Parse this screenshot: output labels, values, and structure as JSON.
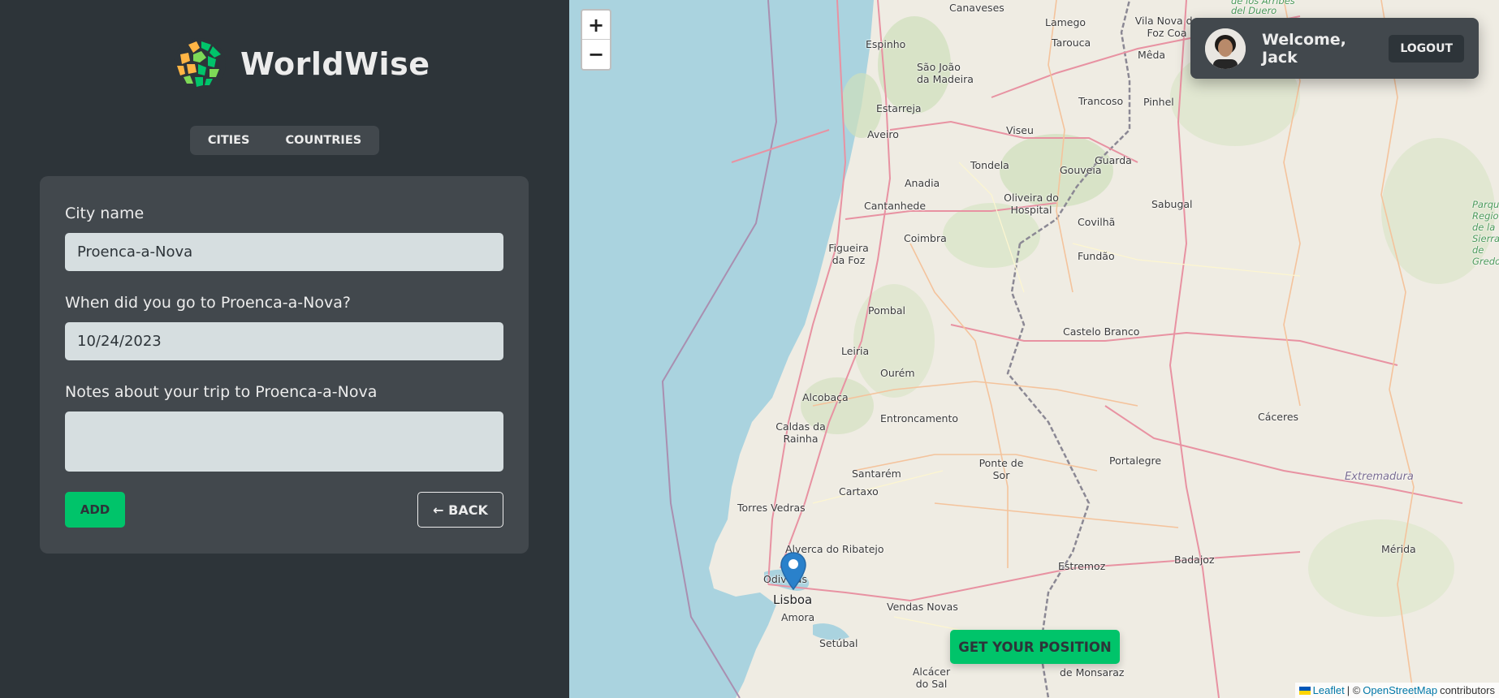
{
  "app": {
    "brand": "WorldWise",
    "brand_colors": {
      "orange": "#ffb545",
      "green": "#00c46a",
      "dark": "#2d3439"
    }
  },
  "nav": {
    "items": [
      {
        "label": "CITIES"
      },
      {
        "label": "COUNTRIES"
      }
    ]
  },
  "form": {
    "city_label": "City name",
    "city_value": "Proenca-a-Nova",
    "date_label": "When did you go to Proenca-a-Nova?",
    "date_value": "10/24/2023",
    "notes_label": "Notes about your trip to Proenca-a-Nova",
    "notes_value": "",
    "add_label": "ADD",
    "back_label": "← BACK"
  },
  "map": {
    "zoom_in": "+",
    "zoom_out": "−",
    "user": {
      "welcome": "Welcome, Jack",
      "logout": "LOGOUT"
    },
    "get_position": "GET YOUR POSITION",
    "attribution": {
      "leaflet": "Leaflet",
      "separator": "| ©",
      "osm": "OpenStreetMap",
      "suffix": "contributors"
    },
    "places": [
      "Canaveses",
      "Lamego",
      "Vila Nova de Foz Coa",
      "Espinho",
      "Tarouca",
      "São João da Madeira",
      "Mêda",
      "Estarreja",
      "Trancoso",
      "Pinhel",
      "Aveiro",
      "Viseu",
      "Guarda",
      "Anadia",
      "Tondela",
      "Gouveia",
      "Cantanhede",
      "Oliveira do Hospital",
      "Sabugal",
      "Coimbra",
      "Covilhã",
      "Figueira da Foz",
      "Fundão",
      "Pombal",
      "Castelo Branco",
      "Leiria",
      "Ourém",
      "Alcobaça",
      "Caldas da Rainha",
      "Entroncamento",
      "Cáceres",
      "Ponte de Sor",
      "Portalegre",
      "Santarém",
      "Cartaxo",
      "Torres Vedras",
      "Alverca do Ribatejo",
      "Odivelas",
      "Lisboa",
      "Estremoz",
      "Badajoz",
      "Mérida",
      "Amora",
      "Vendas Novas",
      "Setúbal",
      "Alcácer do Sal",
      "de Monsaraz",
      "Extremadura",
      "Parque Regional de la Sierra de Gredos",
      "de los Arribes del Duero"
    ]
  }
}
